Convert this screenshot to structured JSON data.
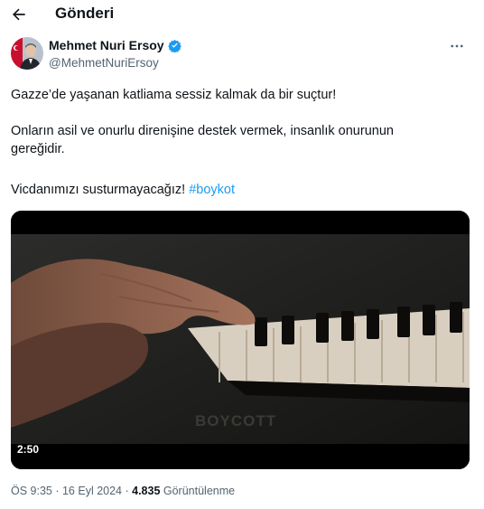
{
  "header": {
    "title": "Gönderi",
    "back_icon": "arrow-left-icon"
  },
  "author": {
    "name": "Mehmet Nuri Ersoy",
    "handle": "@MehmetNuriErsoy",
    "verified_icon": "verified-badge-icon",
    "more_icon": "more-horizontal-icon",
    "accent": "#1d9bf0"
  },
  "tweet": {
    "line1": "Gazze’de yaşanan katliama sessiz kalmak da bir suçtur!",
    "line2": "Onların asil ve onurlu direnişine destek vermek, insanlık onurunun",
    "line3": "gereğidir.",
    "line4_text": "Vicdanımızı susturmayacağız! ",
    "hashtag": "#boykot"
  },
  "media": {
    "overlay_text": "BOYCOTT",
    "duration": "2:50"
  },
  "meta": {
    "time": "ÖS 9:35",
    "separator": " · ",
    "date": "16 Eyl 2024",
    "views_count": "4.835",
    "views_label": " Görüntülenme"
  }
}
